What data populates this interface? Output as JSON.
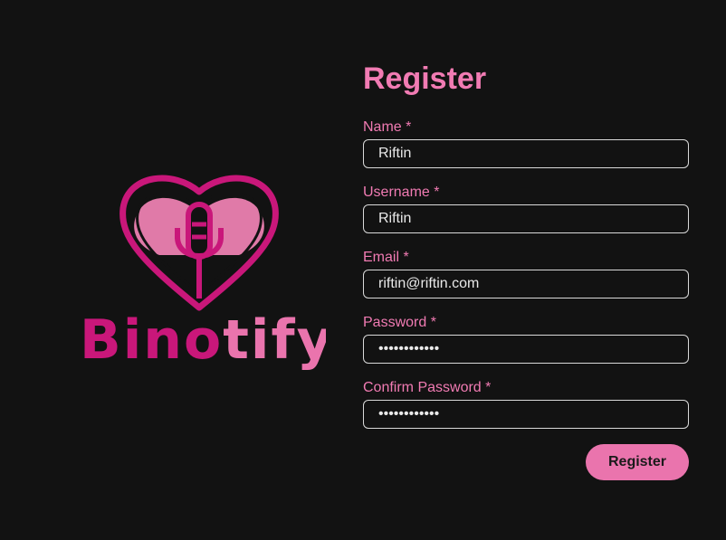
{
  "brand": {
    "logo_text_primary": "Bino",
    "logo_text_secondary": "tify",
    "primary_color": "#c9177a",
    "secondary_color": "#ea74ad"
  },
  "form": {
    "title": "Register",
    "required_marker": "*",
    "fields": [
      {
        "label": "Name",
        "value": "Riftin",
        "type": "text"
      },
      {
        "label": "Username",
        "value": "Riftin",
        "type": "text"
      },
      {
        "label": "Email",
        "value": "riftin@riftin.com",
        "type": "email"
      },
      {
        "label": "Password",
        "value": "••••••••••••",
        "type": "password"
      },
      {
        "label": "Confirm Password",
        "value": "••••••••••••",
        "type": "password"
      }
    ],
    "submit_label": "Register"
  }
}
